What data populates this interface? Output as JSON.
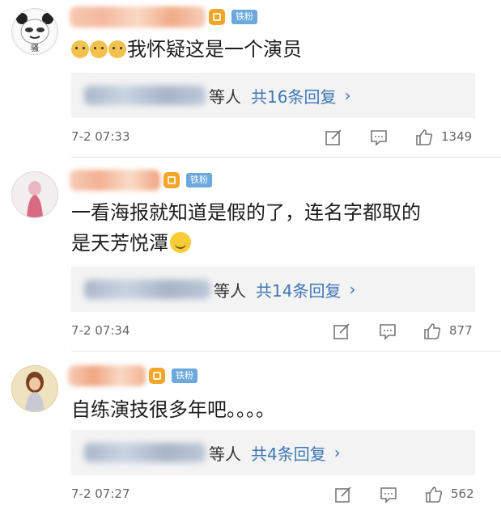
{
  "comments": [
    {
      "badge": "铁粉",
      "text": "我怀疑这是一个演员",
      "deng": "等人",
      "reply_count": "共16条回复",
      "chevron": "›",
      "time": "7-2 07:33",
      "likes": "1349",
      "avatar_text": "骚"
    },
    {
      "badge": "铁粉",
      "text_line1": "一看海报就知道是假的了，连名字都取的",
      "text_line2": "是天芳悦潭",
      "deng": "等人",
      "reply_count": "共14条回复",
      "chevron": "›",
      "time": "7-2 07:34",
      "likes": "877"
    },
    {
      "badge": "铁粉",
      "text": "自练演技很多年吧。。。。",
      "deng": "等人",
      "reply_count": "共4条回复",
      "chevron": "›",
      "time": "7-2 07:27",
      "likes": "562"
    }
  ],
  "colors": {
    "link_blue": "#3d76b5",
    "fan_tag": "#6aa8de",
    "badge_gold": "#f1a52b",
    "reply_bg": "#f3f3f3"
  },
  "icons": [
    "edit-icon",
    "comment-icon",
    "like-icon",
    "gold-badge-icon",
    "dog-emoji",
    "grin-emoji"
  ]
}
